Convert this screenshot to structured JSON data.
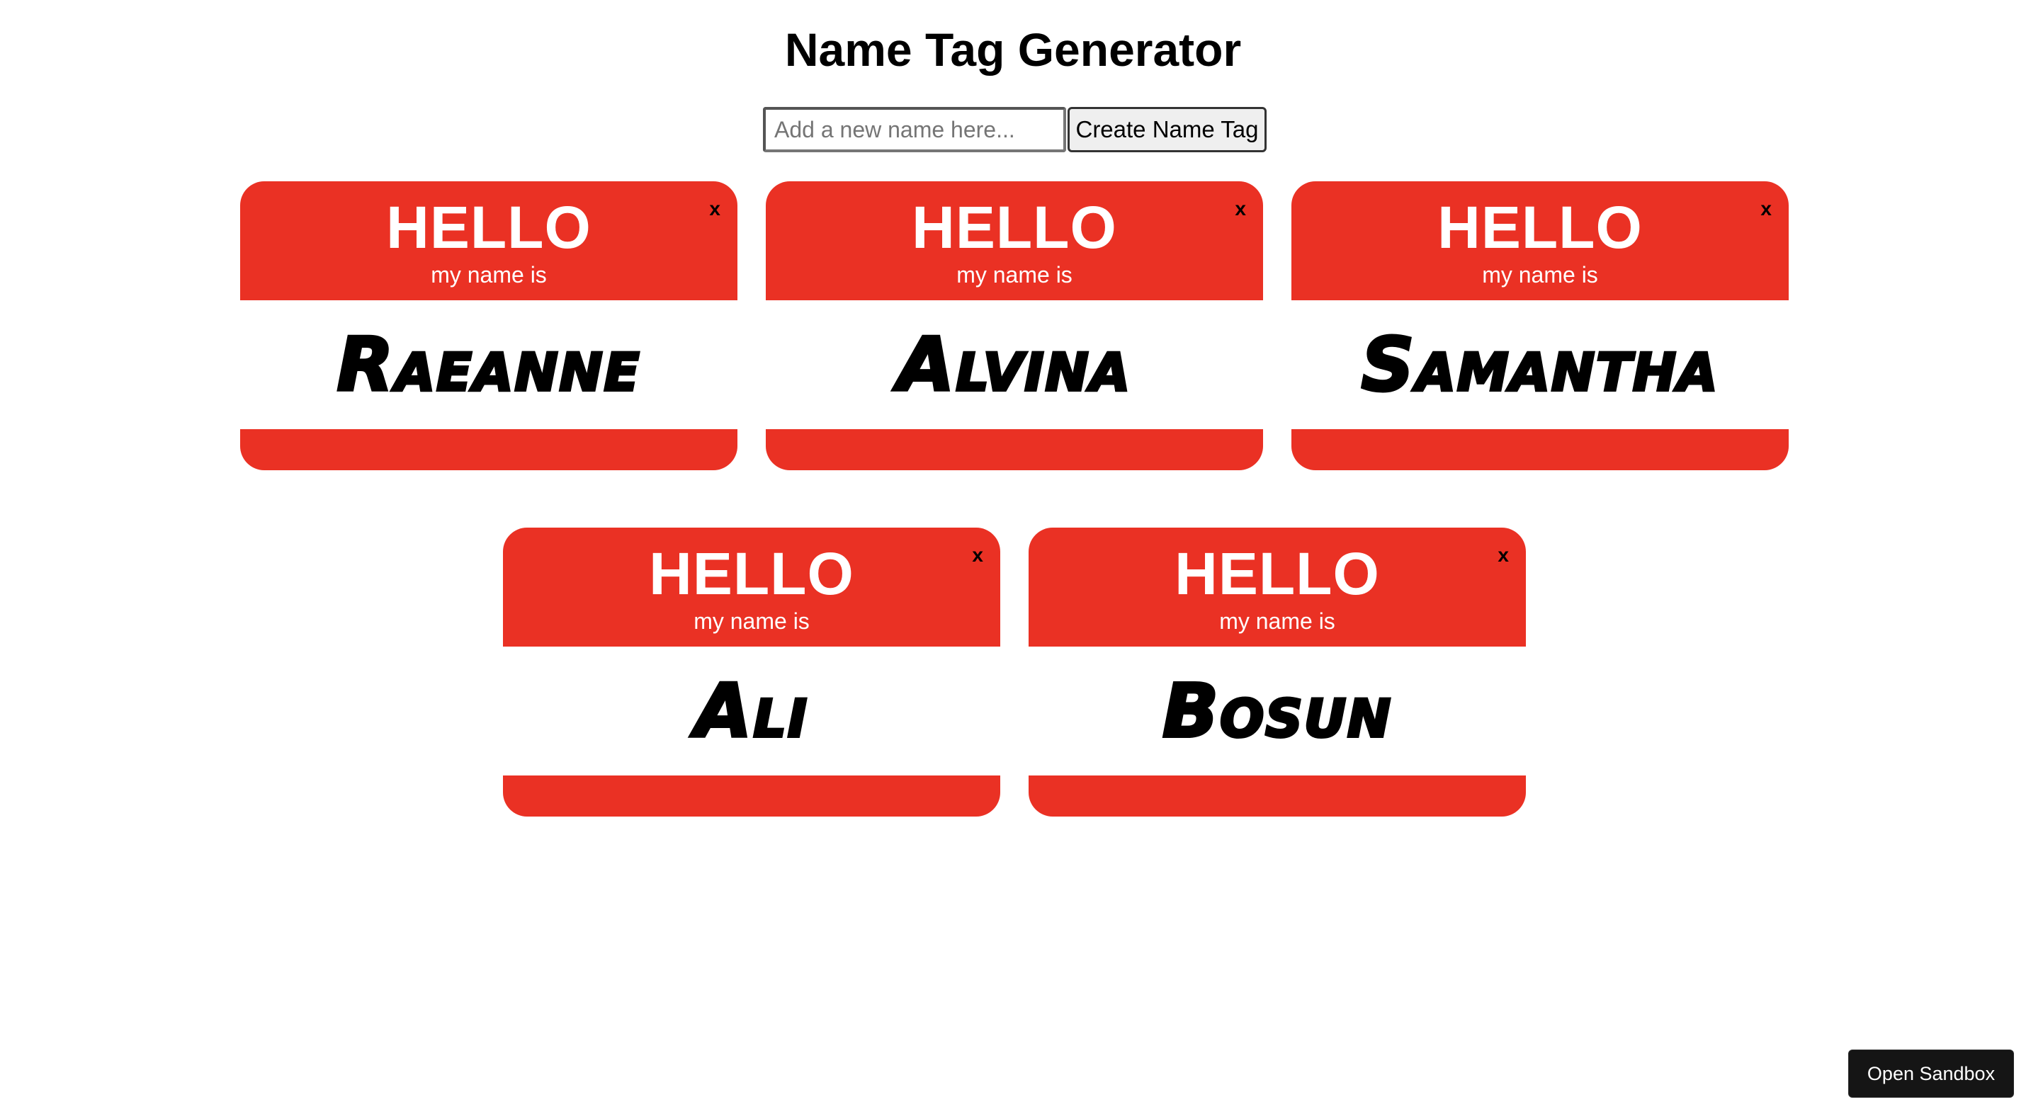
{
  "page": {
    "title": "Name Tag Generator"
  },
  "form": {
    "input_value": "",
    "input_placeholder": "Add a new name here...",
    "create_label": "Create Name Tag"
  },
  "tag_template": {
    "hello": "HELLO",
    "subtitle": "my name is",
    "close": "x"
  },
  "tags": [
    {
      "name": "Raeanne"
    },
    {
      "name": "Alvina"
    },
    {
      "name": "Samantha"
    },
    {
      "name": "Ali"
    },
    {
      "name": "Bosun"
    }
  ],
  "sandbox": {
    "label": "Open Sandbox"
  },
  "colors": {
    "tag_red": "#ea3124",
    "sandbox_bg": "#151515"
  }
}
